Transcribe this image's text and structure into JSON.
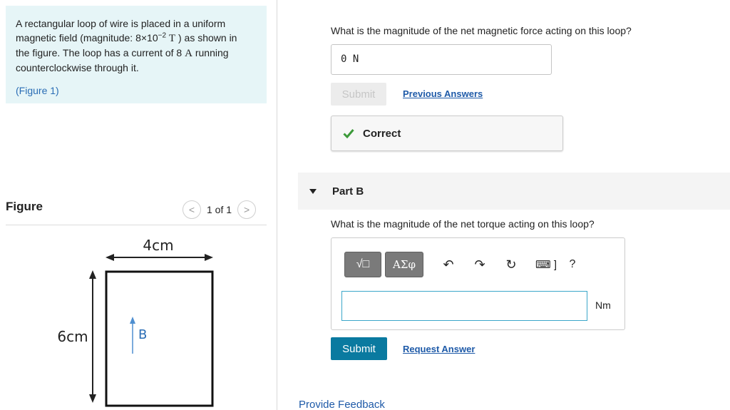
{
  "problem": {
    "line1": "A rectangular loop of wire is placed in a uniform",
    "line2_pre": "magnetic field (magnitude: 8×10",
    "line2_exp": "−2",
    "line2_unit": "T",
    "line2_post": " ) as shown in",
    "line3": "the figure.  The loop has a current of 8 ",
    "line3_unit": "A",
    "line3_post": " running",
    "line4": "counterclockwise through it.",
    "figure_link_open": "(",
    "figure_link": "Figure 1",
    "figure_link_close": ")"
  },
  "figure_panel": {
    "title": "Figure",
    "prev_icon": "<",
    "next_icon": ">",
    "page_indicator": "1 of 1",
    "width_label": "4cm",
    "height_label": "6cm",
    "field_label": "B"
  },
  "part_a": {
    "question": "What is the magnitude of the net magnetic force acting on this loop?",
    "answer_value": "0  N",
    "submit_label": "Submit",
    "previous_answers_label": "Previous Answers",
    "correct_label": "Correct"
  },
  "part_b": {
    "title": "Part B",
    "question": "What is the magnitude of the net torque acting on this loop?",
    "templates_label": "√□",
    "greek_label": "ΑΣφ",
    "undo_icon": "↶",
    "redo_icon": "↷",
    "reset_icon": "↻",
    "keyboard_icon": "⌨ ]",
    "help_icon": "?",
    "answer_value": "",
    "unit": "Nm",
    "submit_label": "Submit",
    "request_answer_label": "Request Answer"
  },
  "footer": {
    "feedback_label": "Provide Feedback"
  },
  "colors": {
    "accent": "#0a7aa0",
    "link": "#1e5aa8",
    "correct_check": "#3c9a3a",
    "problem_bg": "#e6f5f7"
  }
}
